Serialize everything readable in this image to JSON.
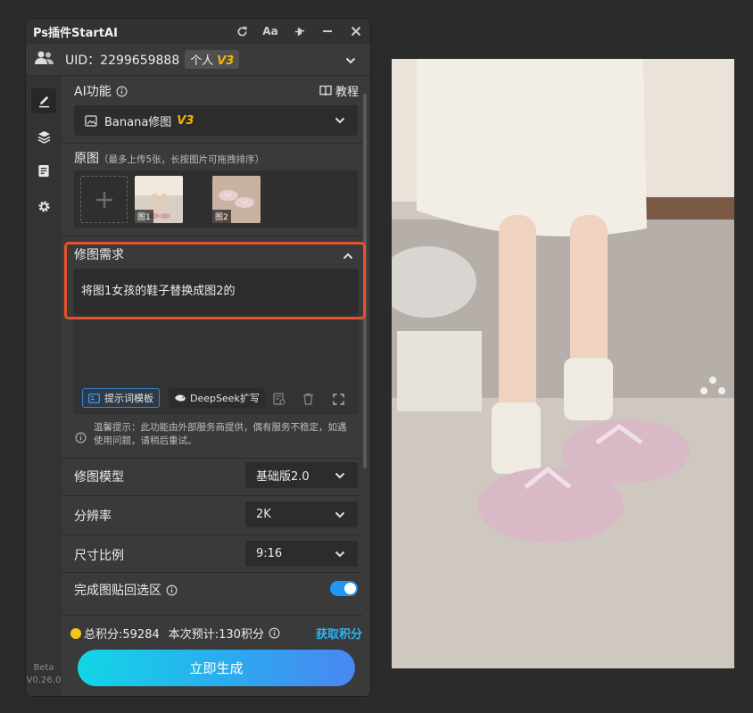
{
  "app": {
    "title": "Ps插件StartAI",
    "window_buttons": [
      "refresh-icon",
      "font-size-icon",
      "pin-icon",
      "minimize-icon",
      "close-icon"
    ],
    "font_btn_label": "Aa"
  },
  "user": {
    "uid": "UID：2299659888",
    "tier": "个人",
    "tier_version": "V3"
  },
  "sidebar": {
    "items": [
      "edit-icon",
      "layers-icon",
      "notes-icon",
      "settings-icon"
    ],
    "beta": "Beta",
    "version": "V0.26.0"
  },
  "ai_feature": {
    "label": "AI功能",
    "tutorial": "教程",
    "selected": "Banana修图",
    "selected_version": "V3"
  },
  "source": {
    "label": "原图",
    "hint": "（最多上传5张，长按图片可拖拽排序）",
    "images": [
      "图1",
      "图2"
    ]
  },
  "request": {
    "label": "修图需求",
    "text": "将图1女孩的鞋子替换成图2的",
    "template_btn": "提示词模板",
    "deepseek_btn": "DeepSeek扩写"
  },
  "notice": {
    "text": "温馨提示：此功能由外部服务商提供，偶有服务不稳定，如遇使用问题，请稍后重试。"
  },
  "settings": {
    "model": {
      "label": "修图模型",
      "value": "基础版2.0"
    },
    "resolution": {
      "label": "分辨率",
      "value": "2K"
    },
    "ratio": {
      "label": "尺寸比例",
      "value": "9:16"
    },
    "paste_back": {
      "label": "完成图贴回选区",
      "on": true
    }
  },
  "footer": {
    "total": "总积分:59284",
    "estimate": "本次预计:130积分",
    "get_points": "获取积分",
    "generate": "立即生成"
  },
  "colors": {
    "accent": "#2196f3",
    "highlight": "#e8502c",
    "version_tag": "#f5b400"
  }
}
